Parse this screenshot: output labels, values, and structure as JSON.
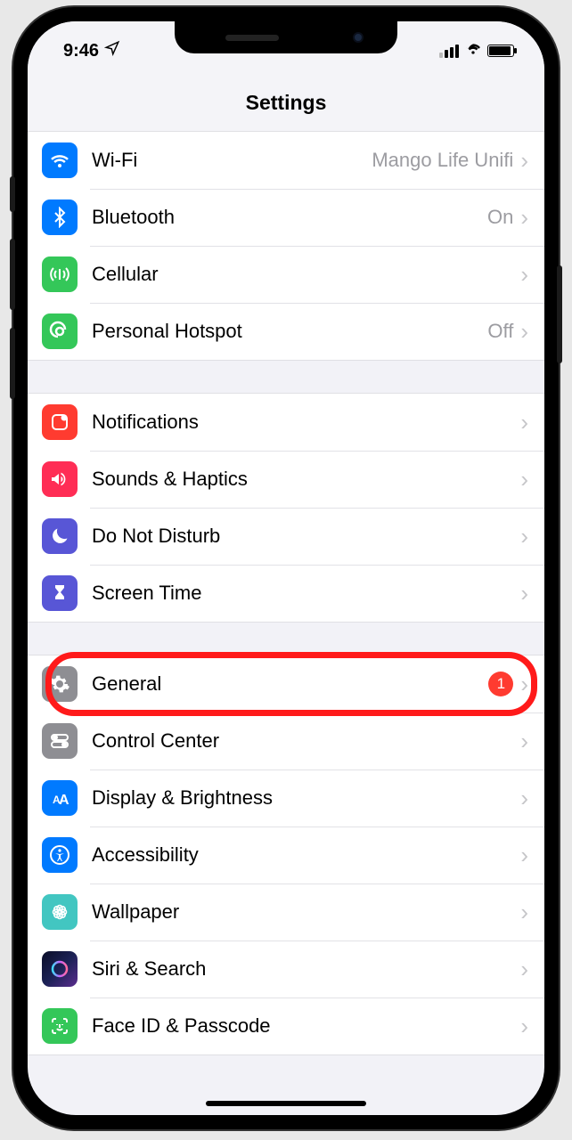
{
  "status": {
    "time": "9:46"
  },
  "header": {
    "title": "Settings"
  },
  "groups": [
    {
      "rows": [
        {
          "id": "wifi",
          "icon": "wifi-icon",
          "color": "ic-blue",
          "label": "Wi-Fi",
          "value": "Mango Life Unifi"
        },
        {
          "id": "bluetooth",
          "icon": "bluetooth-icon",
          "color": "ic-blue",
          "label": "Bluetooth",
          "value": "On"
        },
        {
          "id": "cellular",
          "icon": "cellular-icon",
          "color": "ic-green",
          "label": "Cellular",
          "value": ""
        },
        {
          "id": "hotspot",
          "icon": "hotspot-icon",
          "color": "ic-green",
          "label": "Personal Hotspot",
          "value": "Off"
        }
      ]
    },
    {
      "rows": [
        {
          "id": "notifications",
          "icon": "notifications-icon",
          "color": "ic-red",
          "label": "Notifications",
          "value": ""
        },
        {
          "id": "sounds",
          "icon": "sounds-icon",
          "color": "ic-pink",
          "label": "Sounds & Haptics",
          "value": ""
        },
        {
          "id": "dnd",
          "icon": "moon-icon",
          "color": "ic-purple",
          "label": "Do Not Disturb",
          "value": ""
        },
        {
          "id": "screentime",
          "icon": "hourglass-icon",
          "color": "ic-purple",
          "label": "Screen Time",
          "value": ""
        }
      ]
    },
    {
      "rows": [
        {
          "id": "general",
          "icon": "gear-icon",
          "color": "ic-gray",
          "label": "General",
          "value": "",
          "badge": "1",
          "highlighted": true
        },
        {
          "id": "controlcenter",
          "icon": "switches-icon",
          "color": "ic-gray",
          "label": "Control Center",
          "value": ""
        },
        {
          "id": "display",
          "icon": "display-icon",
          "color": "ic-blue",
          "label": "Display & Brightness",
          "value": ""
        },
        {
          "id": "accessibility",
          "icon": "accessibility-icon",
          "color": "ic-blue",
          "label": "Accessibility",
          "value": ""
        },
        {
          "id": "wallpaper",
          "icon": "wallpaper-icon",
          "color": "ic-teal",
          "label": "Wallpaper",
          "value": ""
        },
        {
          "id": "siri",
          "icon": "siri-icon",
          "color": "ic-siri",
          "label": "Siri & Search",
          "value": ""
        },
        {
          "id": "faceid",
          "icon": "faceid-icon",
          "color": "ic-green",
          "label": "Face ID & Passcode",
          "value": ""
        }
      ]
    }
  ]
}
